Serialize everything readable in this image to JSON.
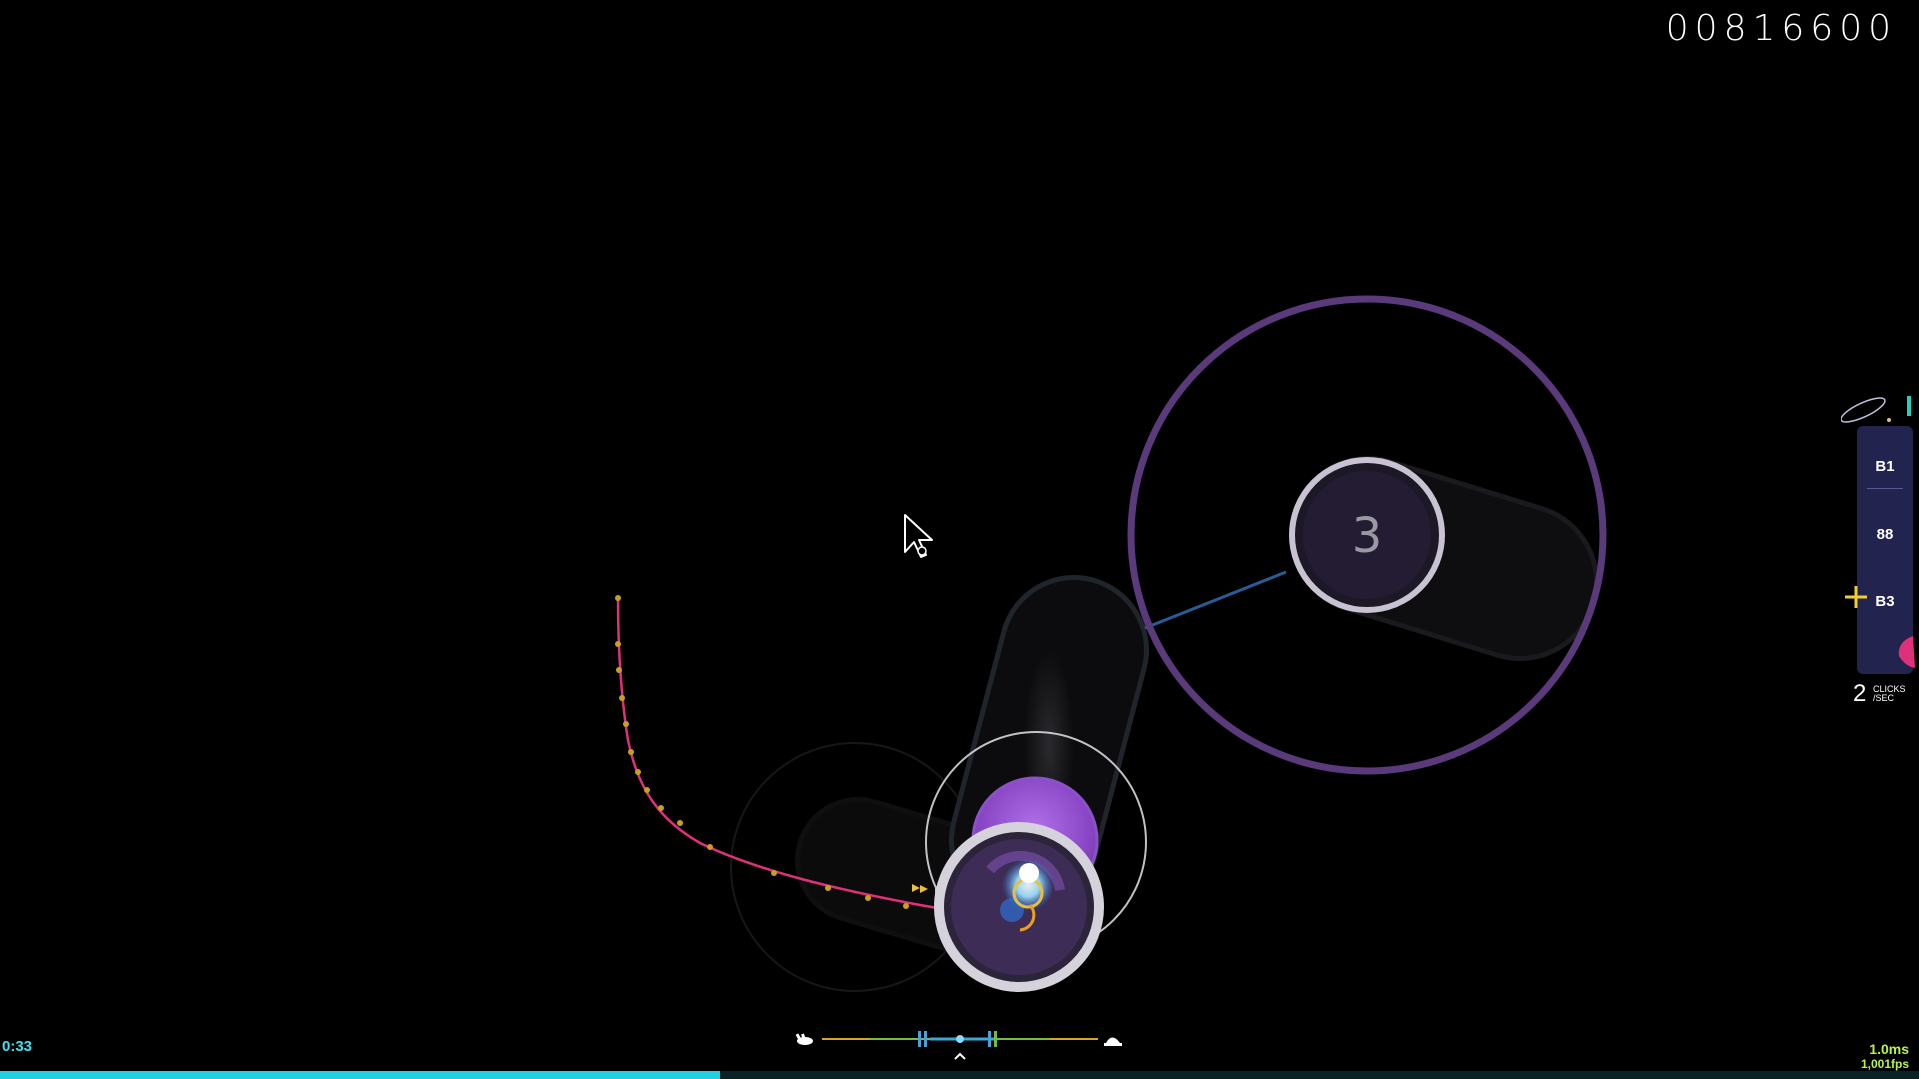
{
  "hud": {
    "score": "00816600",
    "time_elapsed": "0:33",
    "song_progress": 0.375,
    "clicks_per_sec": "2",
    "clicks_unit_line1": "CLICKS",
    "clicks_unit_line2": "/SEC",
    "frame_time": "1.0ms",
    "framerate": "1,001fps"
  },
  "key_overlay": {
    "keys": [
      {
        "label": "B1"
      },
      {
        "label": "88"
      },
      {
        "label": "B3"
      }
    ]
  },
  "hit_objects": {
    "active_circle_number": "3"
  },
  "hit_error_meter": {
    "left_icon": "rabbit-icon",
    "right_icon": "turtle-icon",
    "marker_icon": "caret-up-icon"
  },
  "colors": {
    "approach_circle": "#5a3a7a",
    "slider_ball": "#9b4fd6",
    "replay_path": "#e0307a",
    "progress": "#22d0e0",
    "score_text": "#ffffff",
    "perf_text": "#b8f34a",
    "key_panel": "#23234f"
  }
}
